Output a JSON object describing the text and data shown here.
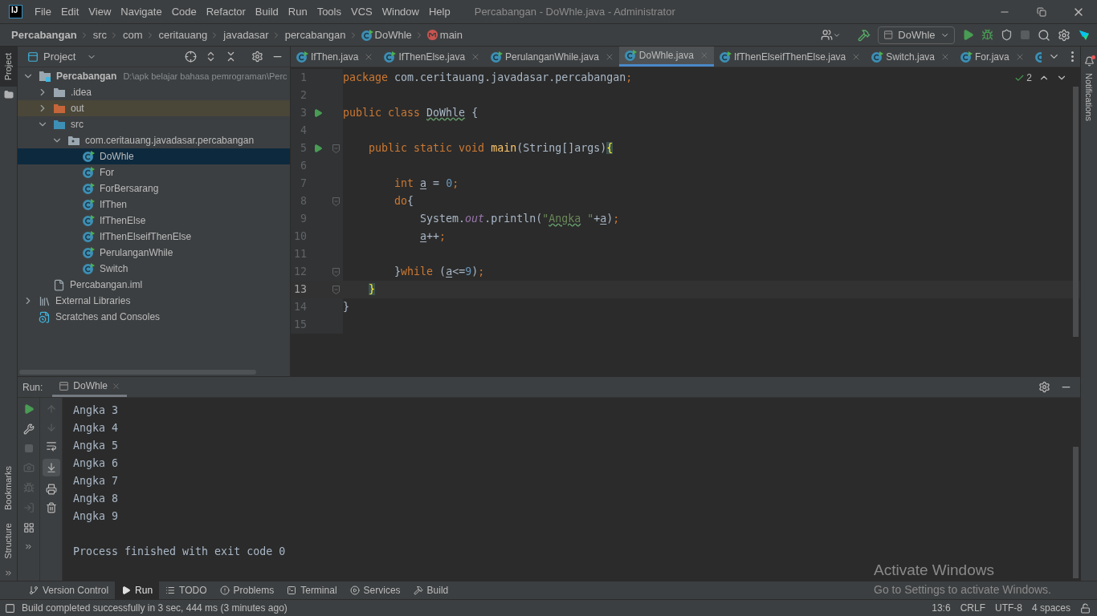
{
  "window": {
    "logo": "IJ",
    "title": "Percabangan - DoWhle.java - Administrator",
    "menu": [
      "File",
      "Edit",
      "View",
      "Navigate",
      "Code",
      "Refactor",
      "Build",
      "Run",
      "Tools",
      "VCS",
      "Window",
      "Help"
    ]
  },
  "breadcrumbs": [
    {
      "label": "Percabangan",
      "kind": "project"
    },
    {
      "label": "src",
      "kind": "plain"
    },
    {
      "label": "com",
      "kind": "plain"
    },
    {
      "label": "ceritauang",
      "kind": "plain"
    },
    {
      "label": "javadasar",
      "kind": "plain"
    },
    {
      "label": "percabangan",
      "kind": "plain"
    },
    {
      "label": "DoWhle",
      "kind": "class"
    },
    {
      "label": "main",
      "kind": "method"
    }
  ],
  "toolbar": {
    "run_config": "DoWhle"
  },
  "stripes": {
    "left_top": [
      {
        "label": "Project",
        "selected": true
      }
    ],
    "left_bottom": [
      {
        "label": "Bookmarks",
        "selected": false
      },
      {
        "label": "Structure",
        "selected": false
      }
    ],
    "right": [
      {
        "label": "Notifications",
        "selected": false
      }
    ]
  },
  "project": {
    "title": "Project",
    "tree": [
      {
        "label": "Percabangan",
        "detail": "D:\\apk belajar bahasa pemrograman\\Perc",
        "kind": "module",
        "expanded": true,
        "selected": false,
        "children": [
          {
            "label": ".idea",
            "kind": "folder",
            "expanded": false,
            "selected": false
          },
          {
            "label": "out",
            "kind": "excluded",
            "expanded": false,
            "selected": false
          },
          {
            "label": "src",
            "kind": "source",
            "expanded": true,
            "selected": false,
            "children": [
              {
                "label": "com.ceritauang.javadasar.percabangan",
                "kind": "package",
                "expanded": true,
                "selected": false,
                "children": [
                  {
                    "label": "DoWhle",
                    "kind": "class",
                    "selected": true
                  },
                  {
                    "label": "For",
                    "kind": "class",
                    "selected": false
                  },
                  {
                    "label": "ForBersarang",
                    "kind": "class",
                    "selected": false
                  },
                  {
                    "label": "IfThen",
                    "kind": "class",
                    "selected": false
                  },
                  {
                    "label": "IfThenElse",
                    "kind": "class",
                    "selected": false
                  },
                  {
                    "label": "IfThenElseifThenElse",
                    "kind": "class",
                    "selected": false
                  },
                  {
                    "label": "PerulanganWhile",
                    "kind": "class",
                    "selected": false
                  },
                  {
                    "label": "Switch",
                    "kind": "class",
                    "selected": false
                  }
                ]
              }
            ]
          },
          {
            "label": "Percabangan.iml",
            "kind": "file",
            "selected": false
          }
        ]
      },
      {
        "label": "External Libraries",
        "kind": "libraries",
        "expanded": false,
        "selected": false
      },
      {
        "label": "Scratches and Consoles",
        "kind": "scratches",
        "selected": false
      }
    ]
  },
  "editor": {
    "tabs": [
      {
        "label": "IfThen.java",
        "selected": false
      },
      {
        "label": "IfThenElse.java",
        "selected": false
      },
      {
        "label": "PerulanganWhile.java",
        "selected": false
      },
      {
        "label": "DoWhle.java",
        "selected": true
      },
      {
        "label": "IfThenElseifThenElse.java",
        "selected": false
      },
      {
        "label": "Switch.java",
        "selected": false
      },
      {
        "label": "For.java",
        "selected": false
      }
    ],
    "inspections": "2",
    "lines": [
      {
        "number": "1",
        "current": false,
        "tokens": [
          {
            "kind": "kw",
            "text": "package"
          },
          {
            "kind": "plain",
            "text": " com.ceritauang.javadasar.percabangan"
          },
          {
            "kind": "kw",
            "text": ";"
          }
        ]
      },
      {
        "number": "2",
        "current": false
      },
      {
        "number": "3",
        "current": false,
        "run": true,
        "tokens": [
          {
            "kind": "kw",
            "text": "public class "
          },
          {
            "kind": "typo",
            "text": "DoWhle"
          },
          {
            "kind": "plain",
            "text": " {"
          }
        ]
      },
      {
        "number": "4",
        "current": false
      },
      {
        "number": "5",
        "current": false,
        "run": true,
        "fold": true,
        "tokens": [
          {
            "kind": "kw",
            "text": "    public static void "
          },
          {
            "kind": "method",
            "text": "main"
          },
          {
            "kind": "plain",
            "text": "(String[]args)"
          },
          {
            "kind": "match",
            "text": "{"
          }
        ]
      },
      {
        "number": "6",
        "current": false
      },
      {
        "number": "7",
        "current": false,
        "tokens": [
          {
            "kind": "kw",
            "text": "        int "
          },
          {
            "kind": "var",
            "text": "a"
          },
          {
            "kind": "plain",
            "text": " = "
          },
          {
            "kind": "num",
            "text": "0"
          },
          {
            "kind": "kw",
            "text": ";"
          }
        ]
      },
      {
        "number": "8",
        "current": false,
        "fold": true,
        "tokens": [
          {
            "kind": "kw",
            "text": "        do"
          },
          {
            "kind": "plain",
            "text": "{"
          }
        ]
      },
      {
        "number": "9",
        "current": false,
        "tokens": [
          {
            "kind": "plain",
            "text": "            System."
          },
          {
            "kind": "field",
            "text": "out"
          },
          {
            "kind": "plain",
            "text": ".println("
          },
          {
            "kind": "str",
            "text": "\""
          },
          {
            "kind": "strtypo",
            "text": "Angka"
          },
          {
            "kind": "str",
            "text": " \""
          },
          {
            "kind": "plain",
            "text": "+"
          },
          {
            "kind": "var",
            "text": "a"
          },
          {
            "kind": "plain",
            "text": ")"
          },
          {
            "kind": "kw",
            "text": ";"
          }
        ]
      },
      {
        "number": "10",
        "current": false,
        "tokens": [
          {
            "kind": "var",
            "text": "            a"
          },
          {
            "kind": "plain",
            "text": "++"
          },
          {
            "kind": "kw",
            "text": ";"
          }
        ]
      },
      {
        "number": "11",
        "current": false
      },
      {
        "number": "12",
        "current": false,
        "fold": true,
        "tokens": [
          {
            "kind": "plain",
            "text": "        }"
          },
          {
            "kind": "kw",
            "text": "while "
          },
          {
            "kind": "plain",
            "text": "("
          },
          {
            "kind": "var",
            "text": "a"
          },
          {
            "kind": "plain",
            "text": "<="
          },
          {
            "kind": "num",
            "text": "9"
          },
          {
            "kind": "plain",
            "text": ")"
          },
          {
            "kind": "kw",
            "text": ";"
          }
        ]
      },
      {
        "number": "13",
        "current": true,
        "fold": true,
        "tokens": [
          {
            "kind": "match",
            "text": "    }"
          }
        ]
      },
      {
        "number": "14",
        "current": false,
        "tokens": [
          {
            "kind": "plain",
            "text": "}"
          }
        ]
      },
      {
        "number": "15",
        "current": false
      }
    ]
  },
  "run": {
    "label": "Run:",
    "tab": "DoWhle",
    "output": [
      "Angka 3",
      "Angka 4",
      "Angka 5",
      "Angka 6",
      "Angka 7",
      "Angka 8",
      "Angka 9"
    ],
    "exit": "Process finished with exit code 0"
  },
  "tool_tabs": [
    {
      "label": "Version Control",
      "selected": false
    },
    {
      "label": "Run",
      "selected": true
    },
    {
      "label": "TODO",
      "selected": false
    },
    {
      "label": "Problems",
      "selected": false
    },
    {
      "label": "Terminal",
      "selected": false
    },
    {
      "label": "Services",
      "selected": false
    },
    {
      "label": "Build",
      "selected": false
    }
  ],
  "status": {
    "message": "Build completed successfully in 3 sec, 444 ms (3 minutes ago)",
    "items": [
      "13:6",
      "CRLF",
      "UTF-8",
      "4 spaces"
    ]
  },
  "activation": {
    "title": "Activate Windows",
    "subtitle": "Go to Settings to activate Windows."
  }
}
